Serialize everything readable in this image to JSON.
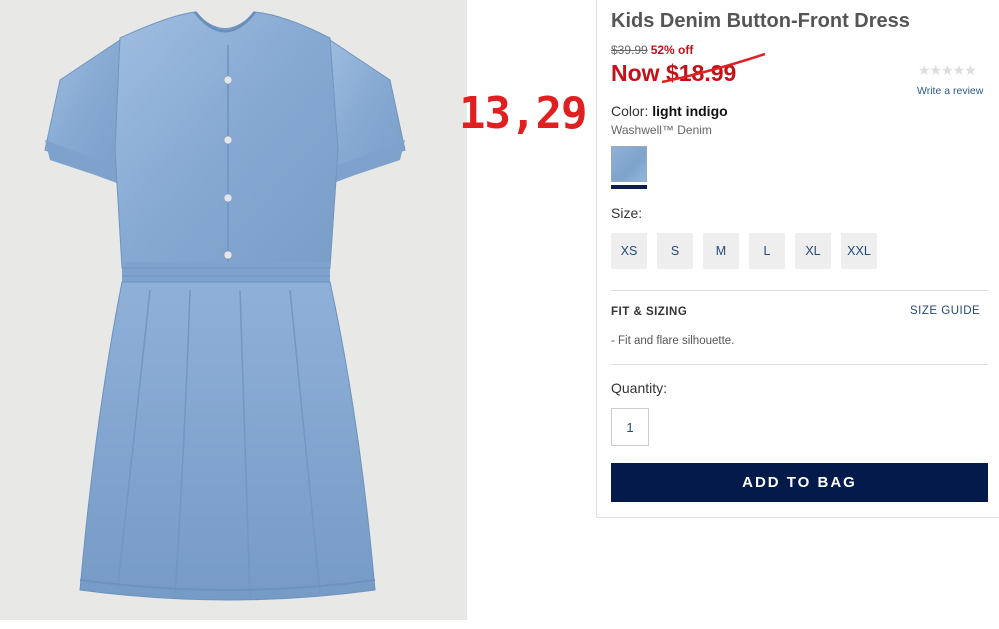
{
  "product": {
    "title": "Kids Denim Button-Front Dress",
    "old_price": "$39.99",
    "percent_off": "52% off",
    "now_price": "Now $18.99",
    "annotation": "13,29",
    "rating_stars": "★★★★★",
    "review_link": "Write a review"
  },
  "color": {
    "label": "Color:",
    "value": "light indigo",
    "fabric": "Washwell™ Denim",
    "swatch_color": "#8fb1d6"
  },
  "sizes": {
    "label": "Size:",
    "options": [
      "XS",
      "S",
      "M",
      "L",
      "XL",
      "XXL"
    ]
  },
  "fit": {
    "heading": "FIT & SIZING",
    "size_guide": "SIZE GUIDE",
    "description": "-  Fit and flare silhouette."
  },
  "quantity": {
    "label": "Quantity:",
    "value": "1"
  },
  "actions": {
    "add_to_bag": "ADD TO BAG"
  },
  "colors": {
    "sale_red": "#c21219",
    "annotation_red": "#e02020",
    "navy": "#031a4a",
    "link_blue": "#244a78"
  }
}
